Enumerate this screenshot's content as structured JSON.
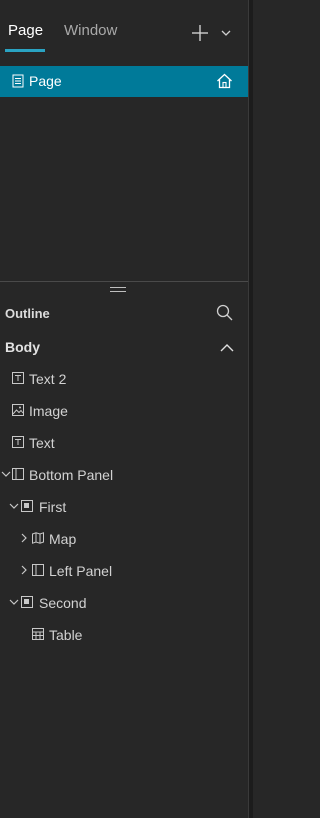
{
  "tabs": {
    "page_label": "Page",
    "window_label": "Window"
  },
  "pages": [
    {
      "label": "Page",
      "is_home": true
    }
  ],
  "outline": {
    "title": "Outline",
    "root_label": "Body",
    "items": [
      {
        "label": "Text 2",
        "icon": "text-icon"
      },
      {
        "label": "Image",
        "icon": "image-icon"
      },
      {
        "label": "Text",
        "icon": "text-icon"
      },
      {
        "label": "Bottom Panel",
        "icon": "panel-icon",
        "expanded": true
      },
      {
        "label": "First",
        "icon": "section-icon",
        "expanded": true
      },
      {
        "label": "Map",
        "icon": "map-icon",
        "expanded": false
      },
      {
        "label": "Left Panel",
        "icon": "panel-icon",
        "expanded": false
      },
      {
        "label": "Second",
        "icon": "section-icon",
        "expanded": true
      },
      {
        "label": "Table",
        "icon": "table-icon"
      }
    ]
  },
  "colors": {
    "accent": "#007a99",
    "tab_underline": "#2aa3c2",
    "background": "#272727"
  }
}
